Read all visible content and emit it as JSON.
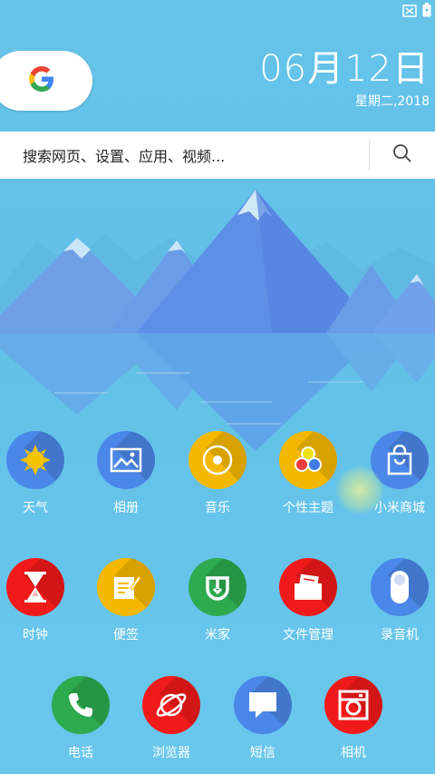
{
  "clock": {
    "date": "06月12日",
    "weekday_year": "星期二,2018"
  },
  "search": {
    "placeholder": "搜索网页、设置、应用、视频..."
  },
  "apps_row1": [
    {
      "label": "天气",
      "color": "#4a87e8"
    },
    {
      "label": "相册",
      "color": "#4a87e8"
    },
    {
      "label": "音乐",
      "color": "#f5b800"
    },
    {
      "label": "个性主题",
      "color": "#f5b800"
    },
    {
      "label": "小米商城",
      "color": "#4a87e8"
    }
  ],
  "apps_row2": [
    {
      "label": "时钟",
      "color": "#f01a1a"
    },
    {
      "label": "便签",
      "color": "#f5b800"
    },
    {
      "label": "米家",
      "color": "#2eaa4f"
    },
    {
      "label": "文件管理",
      "color": "#f01a1a"
    },
    {
      "label": "录音机",
      "color": "#4a87e8"
    }
  ],
  "dock": [
    {
      "label": "电话",
      "color": "#2eaa4f"
    },
    {
      "label": "浏览器",
      "color": "#f01a1a"
    },
    {
      "label": "短信",
      "color": "#4a87e8"
    },
    {
      "label": "相机",
      "color": "#f01a1a"
    }
  ]
}
